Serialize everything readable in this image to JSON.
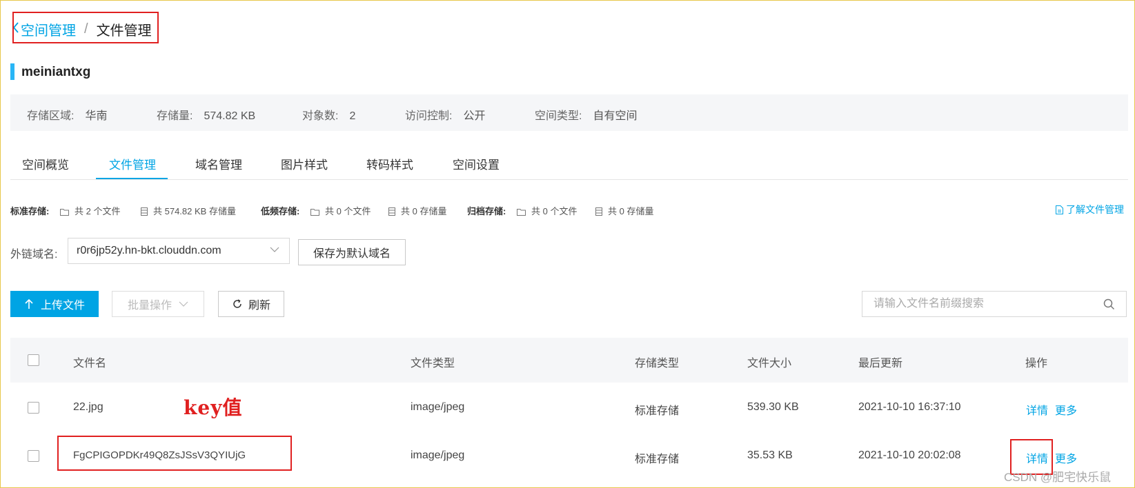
{
  "breadcrumb": {
    "back_icon": "chevron-left-icon",
    "parent": "空间管理",
    "separator": "/",
    "current": "文件管理"
  },
  "bucket": {
    "name": "meiniantxg"
  },
  "info": {
    "region_label": "存储区域:",
    "region_value": "华南",
    "size_label": "存储量:",
    "size_value": "574.82 KB",
    "objects_label": "对象数:",
    "objects_value": "2",
    "access_label": "访问控制:",
    "access_value": "公开",
    "type_label": "空间类型:",
    "type_value": "自有空间"
  },
  "tabs": [
    "空间概览",
    "文件管理",
    "域名管理",
    "图片样式",
    "转码样式",
    "空间设置"
  ],
  "active_tab": "文件管理",
  "summary": {
    "standard_label": "标准存储:",
    "standard_files": "共 2 个文件",
    "standard_size": "共 574.82 KB 存储量",
    "low_label": "低频存储:",
    "low_files": "共 0 个文件",
    "low_size": "共 0 存储量",
    "archive_label": "归档存储:",
    "archive_files": "共 0 个文件",
    "archive_size": "共 0 存储量",
    "learn_link": "了解文件管理"
  },
  "domain": {
    "label": "外链域名:",
    "value": "r0r6jp52y.hn-bkt.clouddn.com",
    "save_button": "保存为默认域名"
  },
  "toolbar": {
    "upload": "上传文件",
    "batch": "批量操作",
    "refresh": "刷新",
    "search_placeholder": "请输入文件名前缀搜索"
  },
  "table": {
    "headers": [
      "文件名",
      "文件类型",
      "存储类型",
      "文件大小",
      "最后更新",
      "操作"
    ],
    "rows": [
      {
        "name": "22.jpg",
        "type": "image/jpeg",
        "storage": "标准存储",
        "size": "539.30 KB",
        "updated": "2021-10-10 16:37:10",
        "detail": "详情",
        "more": "更多"
      },
      {
        "name": "FgCPIGOPDKr49Q8ZsJSsV3QYIUjG",
        "type": "image/jpeg",
        "storage": "标准存储",
        "size": "35.53 KB",
        "updated": "2021-10-10 20:02:08",
        "detail": "详情",
        "more": "更多"
      }
    ]
  },
  "annotation": "key值",
  "watermark": "CSDN @肥宅快乐鼠",
  "colors": {
    "accent": "#00a4e4",
    "annotation": "#e02020",
    "panel": "#f5f6f8"
  }
}
